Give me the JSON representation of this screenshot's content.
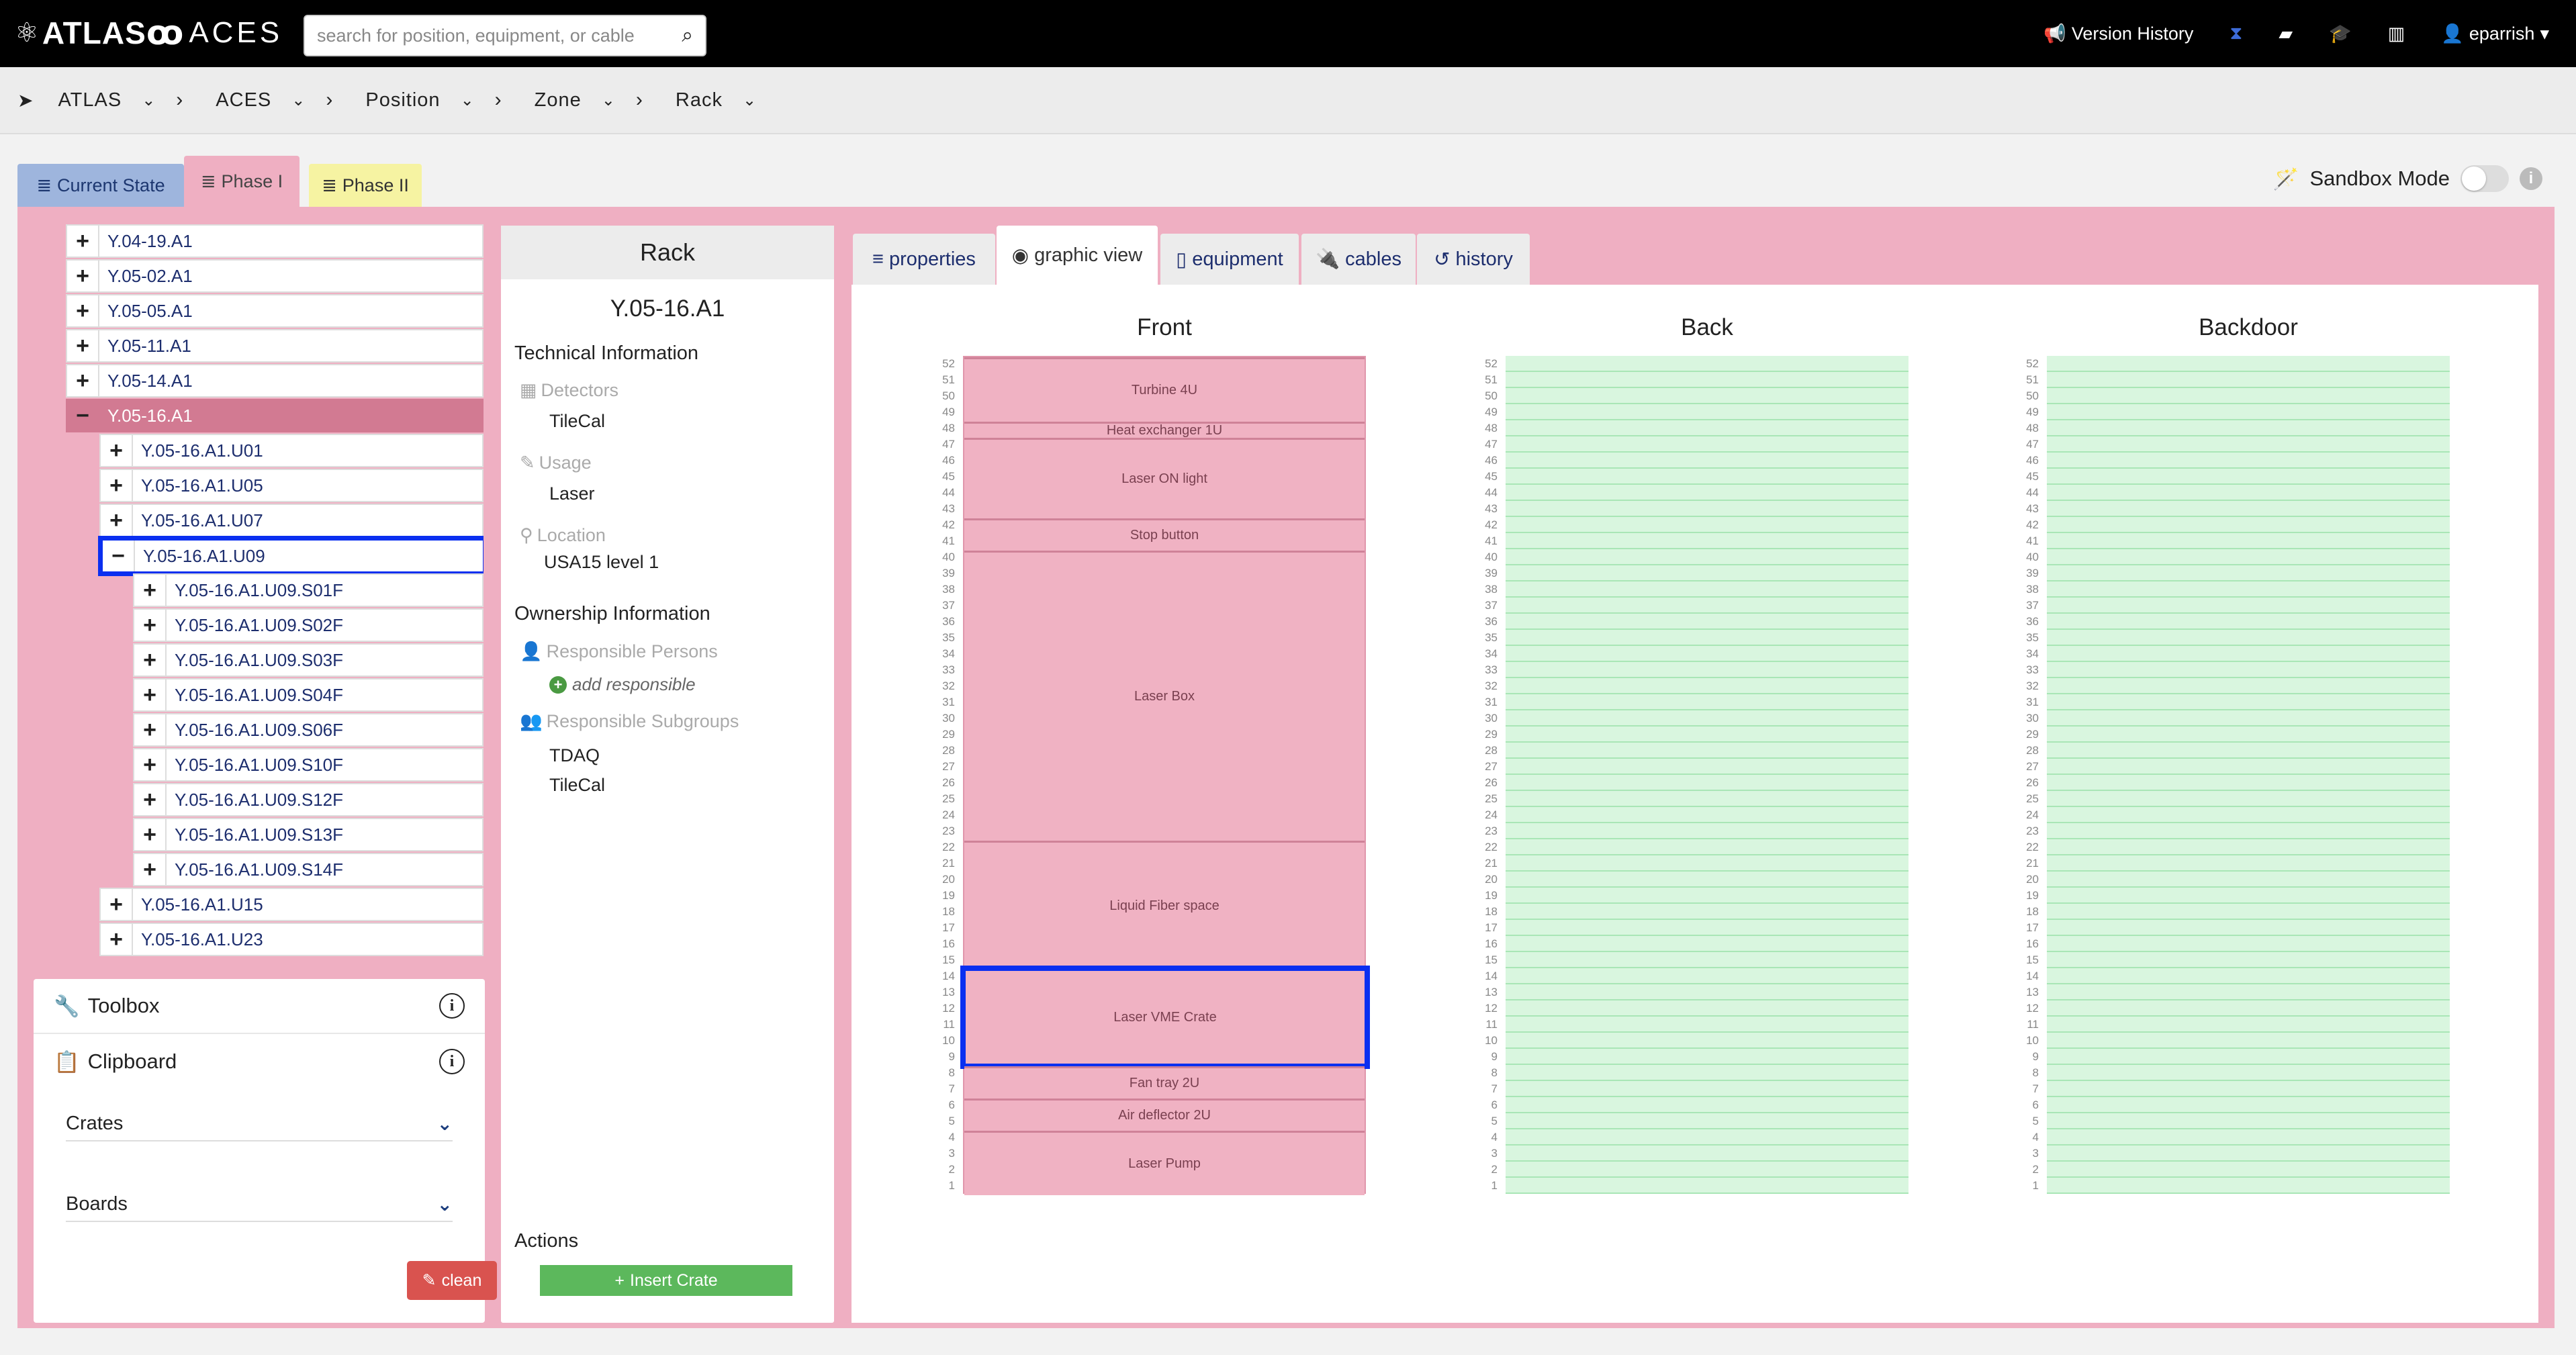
{
  "topbar": {
    "atlas_logo": "ATLAS",
    "aces_logo": "ACES",
    "search_placeholder": "search for position, equipment, or cable",
    "nav": {
      "version_history": "Version History",
      "user": "eparrish"
    }
  },
  "breadcrumb": [
    "ATLAS",
    "ACES",
    "Position",
    "Zone",
    "Rack"
  ],
  "phase_tabs": {
    "current": "Current State",
    "phase1": "Phase I",
    "phase2": "Phase II"
  },
  "sandbox": {
    "label": "Sandbox Mode",
    "enabled": false
  },
  "tree": [
    {
      "label": "Y.04-19.A1",
      "sign": "+",
      "level": 0
    },
    {
      "label": "Y.05-02.A1",
      "sign": "+",
      "level": 0
    },
    {
      "label": "Y.05-05.A1",
      "sign": "+",
      "level": 0
    },
    {
      "label": "Y.05-11.A1",
      "sign": "+",
      "level": 0
    },
    {
      "label": "Y.05-14.A1",
      "sign": "+",
      "level": 0
    },
    {
      "label": "Y.05-16.A1",
      "sign": "−",
      "level": 0,
      "active": true
    },
    {
      "label": "Y.05-16.A1.U01",
      "sign": "+",
      "level": 1
    },
    {
      "label": "Y.05-16.A1.U05",
      "sign": "+",
      "level": 1
    },
    {
      "label": "Y.05-16.A1.U07",
      "sign": "+",
      "level": 1
    },
    {
      "label": "Y.05-16.A1.U09",
      "sign": "−",
      "level": 1,
      "highlight": true
    },
    {
      "label": "Y.05-16.A1.U09.S01F",
      "sign": "+",
      "level": 2
    },
    {
      "label": "Y.05-16.A1.U09.S02F",
      "sign": "+",
      "level": 2
    },
    {
      "label": "Y.05-16.A1.U09.S03F",
      "sign": "+",
      "level": 2
    },
    {
      "label": "Y.05-16.A1.U09.S04F",
      "sign": "+",
      "level": 2
    },
    {
      "label": "Y.05-16.A1.U09.S06F",
      "sign": "+",
      "level": 2
    },
    {
      "label": "Y.05-16.A1.U09.S10F",
      "sign": "+",
      "level": 2
    },
    {
      "label": "Y.05-16.A1.U09.S12F",
      "sign": "+",
      "level": 2
    },
    {
      "label": "Y.05-16.A1.U09.S13F",
      "sign": "+",
      "level": 2
    },
    {
      "label": "Y.05-16.A1.U09.S14F",
      "sign": "+",
      "level": 2
    },
    {
      "label": "Y.05-16.A1.U15",
      "sign": "+",
      "level": 1
    },
    {
      "label": "Y.05-16.A1.U23",
      "sign": "+",
      "level": 1
    }
  ],
  "toolbox": {
    "title": "Toolbox"
  },
  "clipboard": {
    "title": "Clipboard",
    "crates": "Crates",
    "boards": "Boards",
    "clean": "clean"
  },
  "properties": {
    "header": "Rack",
    "name": "Y.05-16.A1",
    "technical_title": "Technical Information",
    "detectors_label": "Detectors",
    "detectors_value": "TileCal",
    "usage_label": "Usage",
    "usage_value": "Laser",
    "location_label": "Location",
    "location_value": "USA15 level 1",
    "ownership_title": "Ownership Information",
    "responsible_persons_label": "Responsible Persons",
    "add_responsible": "add responsible",
    "responsible_subgroups_label": "Responsible Subgroups",
    "subgroups": [
      "TDAQ",
      "TileCal"
    ],
    "actions_title": "Actions",
    "insert_crate": "Insert Crate"
  },
  "view_tabs": {
    "properties": "properties",
    "graphic_view": "graphic view",
    "equipment": "equipment",
    "cables": "cables",
    "history": "history"
  },
  "racks": {
    "front_title": "Front",
    "back_title": "Back",
    "backdoor_title": "Backdoor",
    "total_units": 52,
    "front_slots": [
      {
        "label": "Turbine 4U",
        "top_u": 52,
        "bottom_u": 49
      },
      {
        "label": "Heat exchanger 1U",
        "top_u": 48,
        "bottom_u": 48
      },
      {
        "label": "Laser ON light",
        "top_u": 47,
        "bottom_u": 43
      },
      {
        "label": "Stop button",
        "top_u": 42,
        "bottom_u": 41
      },
      {
        "label": "Laser Box",
        "top_u": 40,
        "bottom_u": 23
      },
      {
        "label": "Liquid Fiber space",
        "top_u": 22,
        "bottom_u": 15
      },
      {
        "label": "Laser VME Crate",
        "top_u": 14,
        "bottom_u": 9,
        "highlight": true
      },
      {
        "label": "Fan tray 2U",
        "top_u": 8,
        "bottom_u": 7
      },
      {
        "label": "Air deflector 2U",
        "top_u": 6,
        "bottom_u": 5
      },
      {
        "label": "Laser Pump",
        "top_u": 4,
        "bottom_u": 1
      }
    ]
  },
  "colors": {
    "main_bg": "#efafc2",
    "active_row": "#d27a92",
    "highlight": "#0a2ff0",
    "rack_front": "#f0b2c3",
    "rack_empty": "#d9f6df"
  }
}
